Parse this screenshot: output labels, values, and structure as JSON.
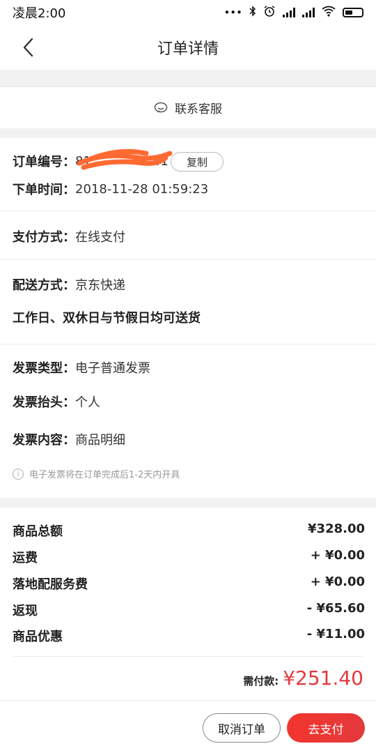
{
  "status_bar": {
    "time": "凌晨2:00",
    "icons": [
      "more-dots-icon",
      "bluetooth-icon",
      "alarm-icon",
      "signal-icon",
      "signal-icon",
      "wifi-icon",
      "battery-icon"
    ]
  },
  "nav": {
    "title": "订单详情",
    "back_icon": "chevron-left-icon"
  },
  "contact": {
    "label": "联系客服",
    "icon": "chat-bubble-icon"
  },
  "order": {
    "number_label": "订单编号：",
    "number_visible_start": "81",
    "number_visible_end": "41",
    "copy_label": "复制",
    "time_label": "下单时间：",
    "time_value": "2018-11-28 01:59:23"
  },
  "payment": {
    "label": "支付方式：",
    "value": "在线支付"
  },
  "delivery": {
    "label": "配送方式：",
    "value": "京东快递",
    "schedule": "工作日、双休日与节假日均可送货"
  },
  "invoice": {
    "type_label": "发票类型：",
    "type_value": "电子普通发票",
    "title_label": "发票抬头：",
    "title_value": "个人",
    "content_label": "发票内容：",
    "content_value": "商品明细",
    "note": "电子发票将在订单完成后1-2天内开具"
  },
  "prices": [
    {
      "label": "商品总额",
      "value": "¥328.00"
    },
    {
      "label": "运费",
      "value": "+ ¥0.00"
    },
    {
      "label": "落地配服务费",
      "value": "+ ¥0.00"
    },
    {
      "label": "返现",
      "value": "- ¥65.60"
    },
    {
      "label": "商品优惠",
      "value": "- ¥11.00"
    }
  ],
  "total": {
    "label": "需付款:",
    "value": "¥251.40"
  },
  "actions": {
    "cancel": "取消订单",
    "pay": "去支付"
  },
  "colors": {
    "accent": "#e4393c",
    "pay_gradient": [
      "#f2352c",
      "#e4393c"
    ],
    "redaction": "#ff6a33"
  }
}
